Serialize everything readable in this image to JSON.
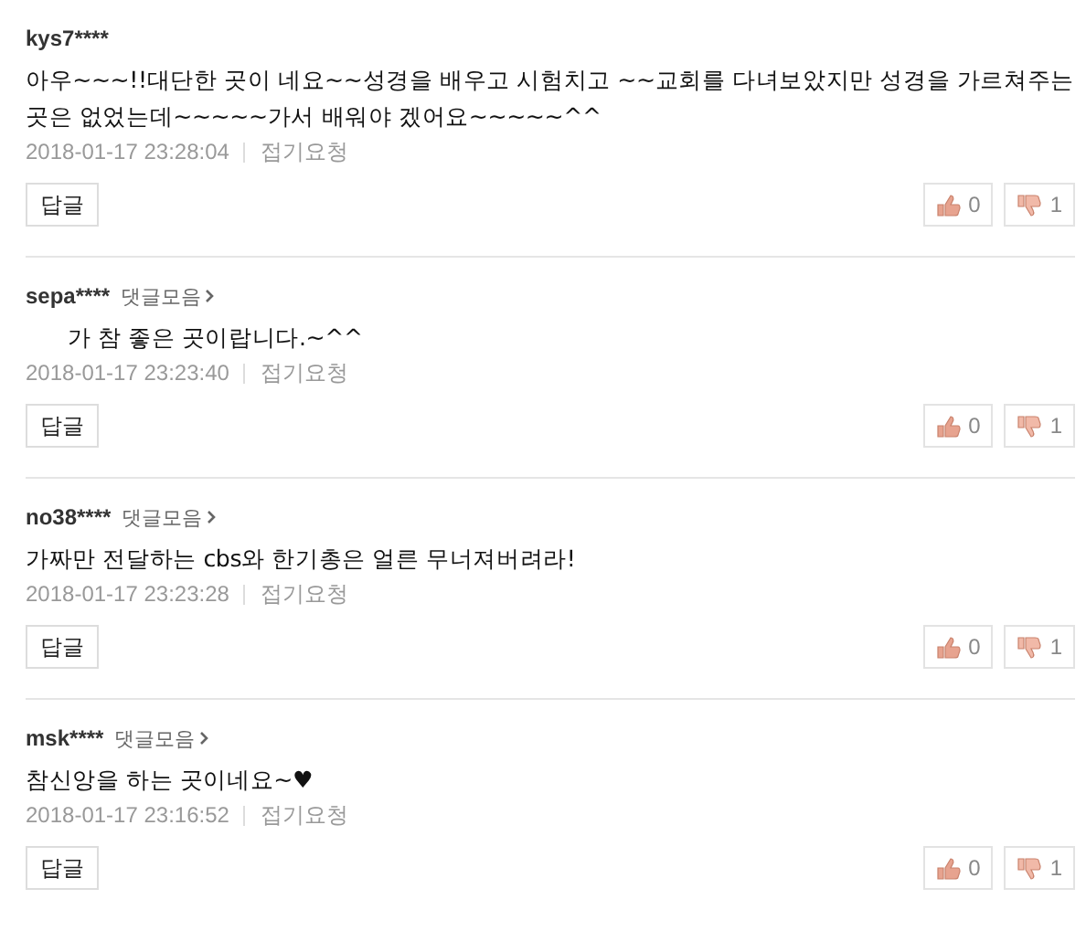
{
  "comments": [
    {
      "user": "kys7****",
      "body": "아우~~~!!대단한 곳이 네요~~성경을 배우고 시험치고 ~~교회를 다녀보았지만 성경을 가르쳐주는곳은 없었는데~~~~~가서 배워야 겠어요~~~~~^^",
      "date": "2018-01-17 23:28:04",
      "fold": "접기요청",
      "reply": "답글",
      "likes": "0",
      "dislikes": "1"
    },
    {
      "user": "sepa****",
      "collection_link": "댓글모음",
      "body": "      가 참 좋은 곳이랍니다.~^^",
      "date": "2018-01-17 23:23:40",
      "fold": "접기요청",
      "reply": "답글",
      "likes": "0",
      "dislikes": "1"
    },
    {
      "user": "no38****",
      "collection_link": "댓글모음",
      "body": "가짜만 전달하는 cbs와 한기총은 얼른 무너져버려라!",
      "date": "2018-01-17 23:23:28",
      "fold": "접기요청",
      "reply": "답글",
      "likes": "0",
      "dislikes": "1"
    },
    {
      "user": "msk****",
      "collection_link": "댓글모음",
      "body": "참신앙을 하는 곳이네요~♥",
      "date": "2018-01-17 23:16:52",
      "fold": "접기요청",
      "reply": "답글",
      "likes": "0",
      "dislikes": "1"
    }
  ]
}
